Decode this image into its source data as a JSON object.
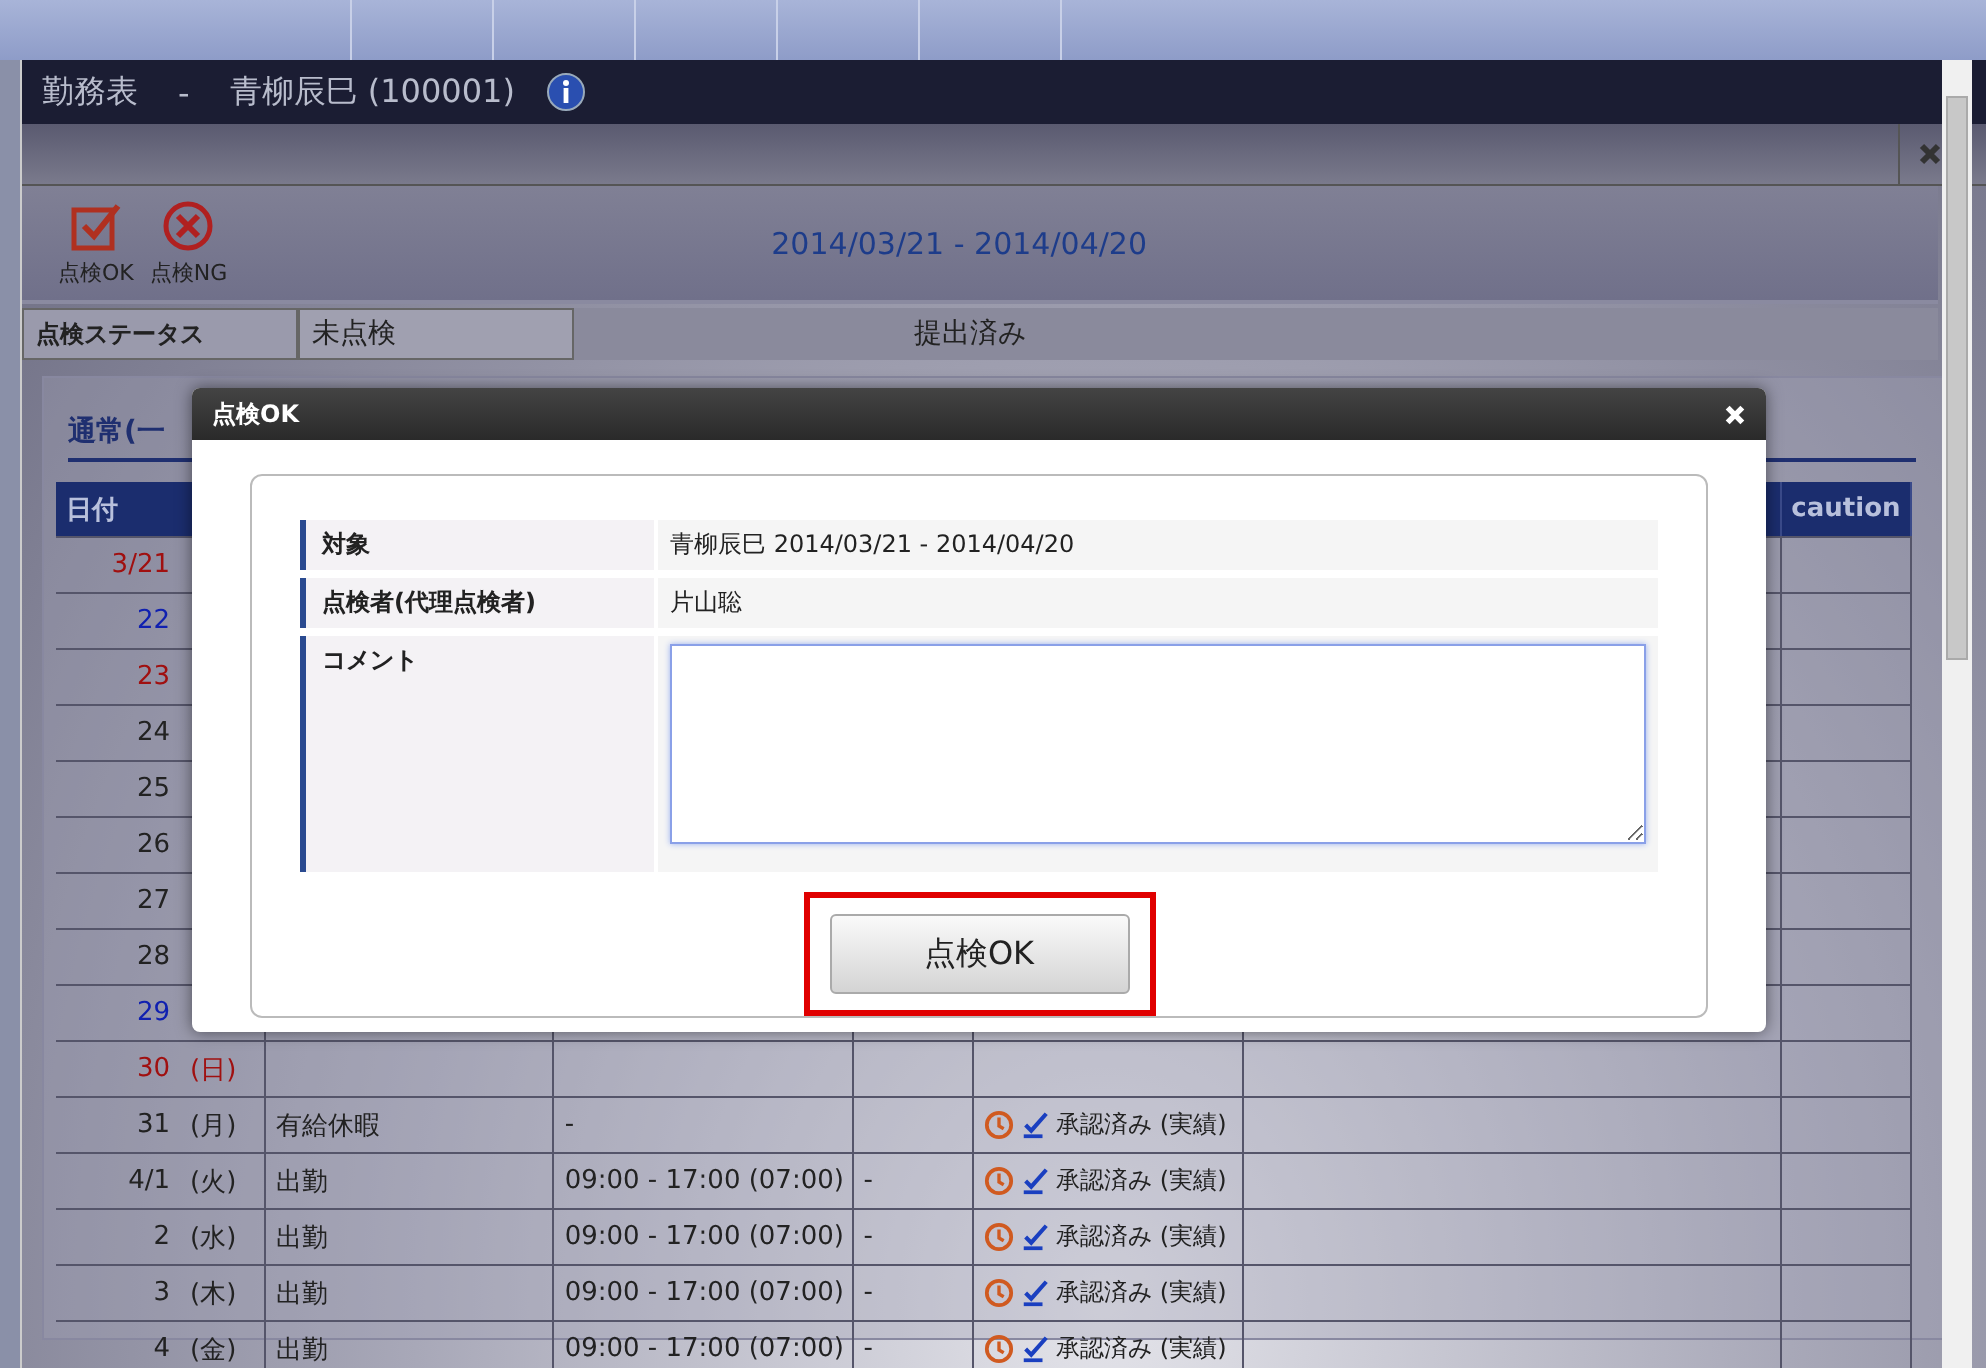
{
  "window": {
    "title": "勤務表",
    "separator": "-",
    "user": "青柳辰巳 (100001)"
  },
  "toolbar": {
    "buttons": [
      {
        "label": "点検OK",
        "kind": "ok"
      },
      {
        "label": "点検NG",
        "kind": "ng"
      }
    ],
    "period": "2014/03/21 - 2014/04/20"
  },
  "status": {
    "label": "点検ステータス",
    "value": "未点検",
    "submission": "提出済み"
  },
  "section": {
    "title": "通常(一"
  },
  "table": {
    "columns": [
      "日付",
      "caution"
    ],
    "rows": [
      {
        "day": "3/21",
        "kind": "holiday"
      },
      {
        "day": "22",
        "kind": "saturday"
      },
      {
        "day": "23",
        "kind": "holiday"
      },
      {
        "day": "24",
        "kind": "weekday"
      },
      {
        "day": "25",
        "kind": "weekday"
      },
      {
        "day": "26",
        "kind": "weekday"
      },
      {
        "day": "27",
        "kind": "weekday"
      },
      {
        "day": "28",
        "kind": "weekday"
      },
      {
        "day": "29",
        "kind": "saturday"
      },
      {
        "day": "30",
        "weekday": "(日)",
        "kind": "holiday"
      },
      {
        "day": "31",
        "weekday": "(月)",
        "kind": "weekday",
        "type": "有給休暇",
        "time": "-",
        "status": "承認済み (実績)"
      },
      {
        "day": "4/1",
        "weekday": "(火)",
        "kind": "weekday",
        "type": "出勤",
        "time": "09:00 - 17:00 (07:00)",
        "extra": "-",
        "status": "承認済み (実績)"
      },
      {
        "day": "2",
        "weekday": "(水)",
        "kind": "weekday",
        "type": "出勤",
        "time": "09:00 - 17:00 (07:00)",
        "extra": "-",
        "status": "承認済み (実績)"
      },
      {
        "day": "3",
        "weekday": "(木)",
        "kind": "weekday",
        "type": "出勤",
        "time": "09:00 - 17:00 (07:00)",
        "extra": "-",
        "status": "承認済み (実績)"
      },
      {
        "day": "4",
        "weekday": "(金)",
        "kind": "weekday",
        "type": "出勤",
        "time": "09:00 - 17:00 (07:00)",
        "extra": "-",
        "status": "承認済み (実績)"
      }
    ]
  },
  "dialog": {
    "title": "点検OK",
    "fields": [
      {
        "label": "対象",
        "value": "青柳辰巳 2014/03/21 - 2014/04/20",
        "kind": "text"
      },
      {
        "label": "点検者(代理点検者)",
        "value": "片山聡",
        "kind": "text"
      },
      {
        "label": "コメント",
        "kind": "textarea"
      }
    ],
    "button": "点検OK"
  }
}
